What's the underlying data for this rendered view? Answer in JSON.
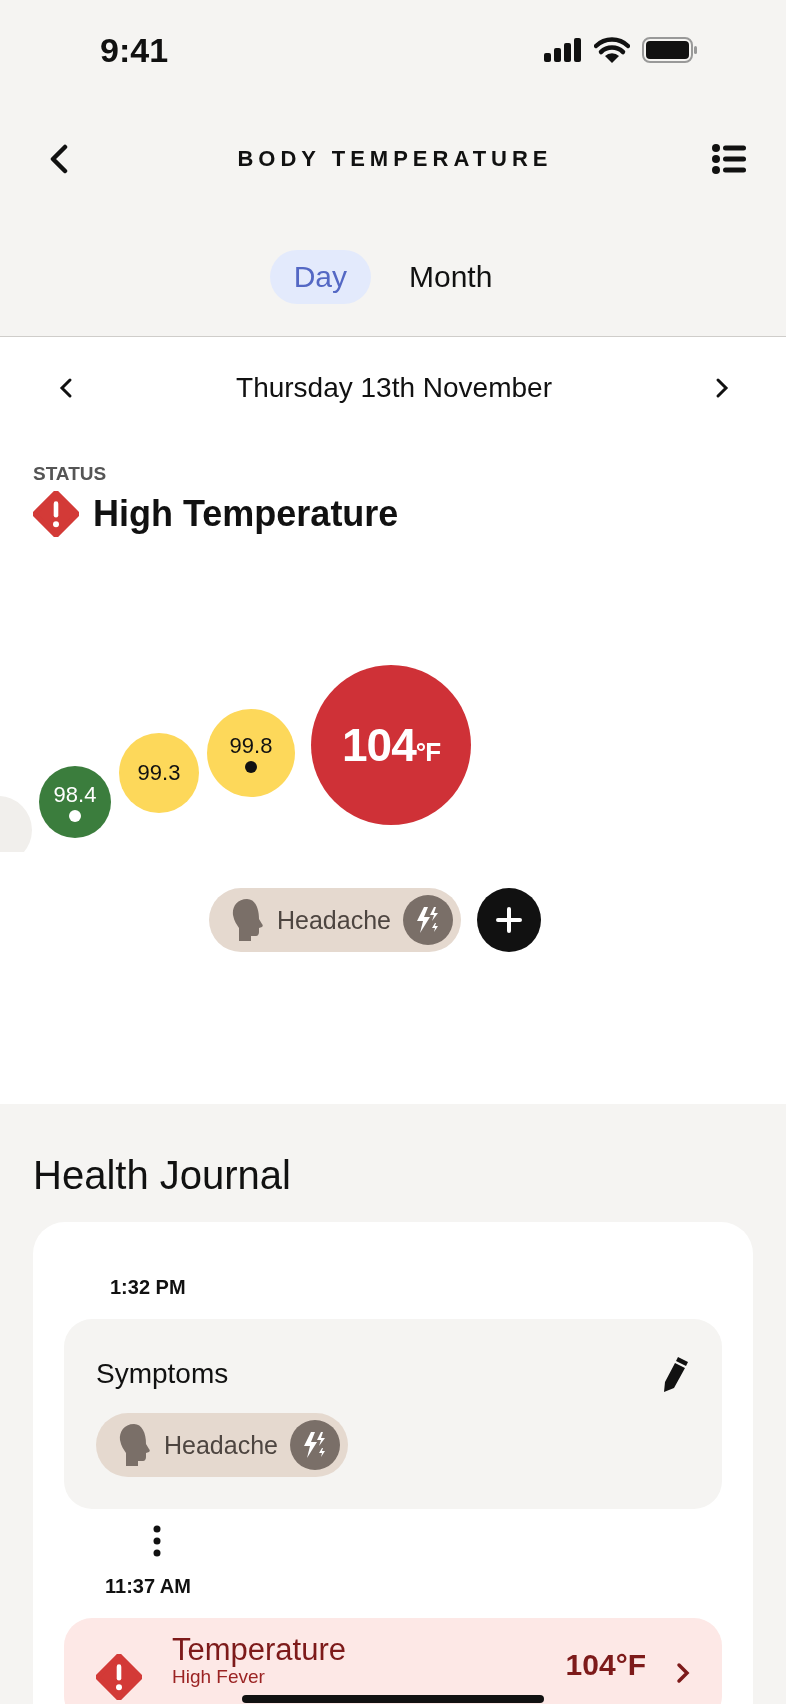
{
  "status_bar": {
    "time": "9:41"
  },
  "header": {
    "title": "BODY TEMPERATURE"
  },
  "tabs": [
    {
      "label": "Day",
      "selected": true
    },
    {
      "label": "Month",
      "selected": false
    }
  ],
  "date_nav": {
    "date": "Thursday 13th November"
  },
  "status": {
    "label": "STATUS",
    "value": "High Temperature"
  },
  "readings": [
    {
      "value": "98.4",
      "color": "#3b7d3d",
      "marked": true
    },
    {
      "value": "99.3",
      "color": "#fdd85a",
      "marked": false
    },
    {
      "value": "99.8",
      "color": "#fdd85a",
      "marked": true
    },
    {
      "value": "104",
      "unit": "°F",
      "color": "#cf3137",
      "marked": false
    }
  ],
  "symptom_chips": [
    {
      "label": "Headache"
    }
  ],
  "journal": {
    "title": "Health Journal",
    "entries": [
      {
        "kind": "symptoms",
        "time": "1:32 PM",
        "title": "Symptoms",
        "chips": [
          {
            "label": "Headache"
          }
        ]
      },
      {
        "kind": "temperature",
        "time": "11:37 AM",
        "title": "Temperature",
        "subtitle": "High Fever",
        "value": "104°F"
      }
    ]
  }
}
